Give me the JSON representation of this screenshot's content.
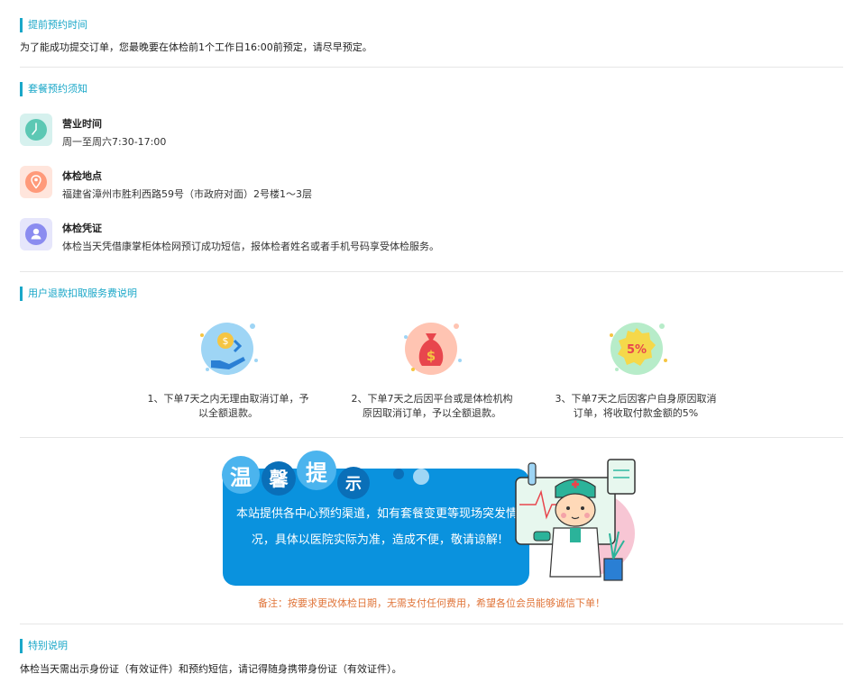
{
  "advance": {
    "title": "提前预约时间",
    "text": "为了能成功提交订单，您最晚要在体检前1个工作日16:00前预定，请尽早预定。"
  },
  "notice": {
    "title": "套餐预约须知",
    "items": [
      {
        "title": "营业时间",
        "desc": "周一至周六7:30-17:00",
        "icon": "clock-icon",
        "color": "#5cc8b4"
      },
      {
        "title": "体检地点",
        "desc": "福建省漳州市胜利西路59号（市政府对面）2号楼1～3层",
        "icon": "location-pin-icon",
        "color": "#ff9a7a"
      },
      {
        "title": "体检凭证",
        "desc": "体检当天凭借康掌柜体检网预订成功短信，报体检者姓名或者手机号码享受体检服务。",
        "icon": "user-icon",
        "color": "#8b8cf0"
      }
    ]
  },
  "refund": {
    "title": "用户退款扣取服务费说明",
    "items": [
      {
        "icon": "coin-refund-icon",
        "line1": "1、下单7天之内无理由取消订单，予",
        "line2": "以全额退款。"
      },
      {
        "icon": "money-bag-icon",
        "line1": "2、下单7天之后因平台或是体检机构",
        "line2": "原因取消订单，予以全额退款。"
      },
      {
        "icon": "five-percent-icon",
        "line1": "3、下单7天之后因客户自身原因取消",
        "line2": "订单，将收取付款金额的5%"
      }
    ]
  },
  "tip": {
    "chars": [
      "温",
      "馨",
      "提",
      "示"
    ],
    "line1": "本站提供各中心预约渠道，如有套餐变更等现场突发情",
    "line2": "况，具体以医院实际为准，造成不便，敬请谅解!",
    "remark": "备注：按要求更改体检日期，无需支付任何费用，希望各位会员能够诚信下单！"
  },
  "special": {
    "title": "特别说明",
    "text": "体检当天需出示身份证（有效证件）和预约短信，请记得随身携带身份证（有效证件）。"
  },
  "colors": {
    "accent": "#1aa7c8",
    "banner": "#0a92de",
    "remark": "#e0753a"
  }
}
